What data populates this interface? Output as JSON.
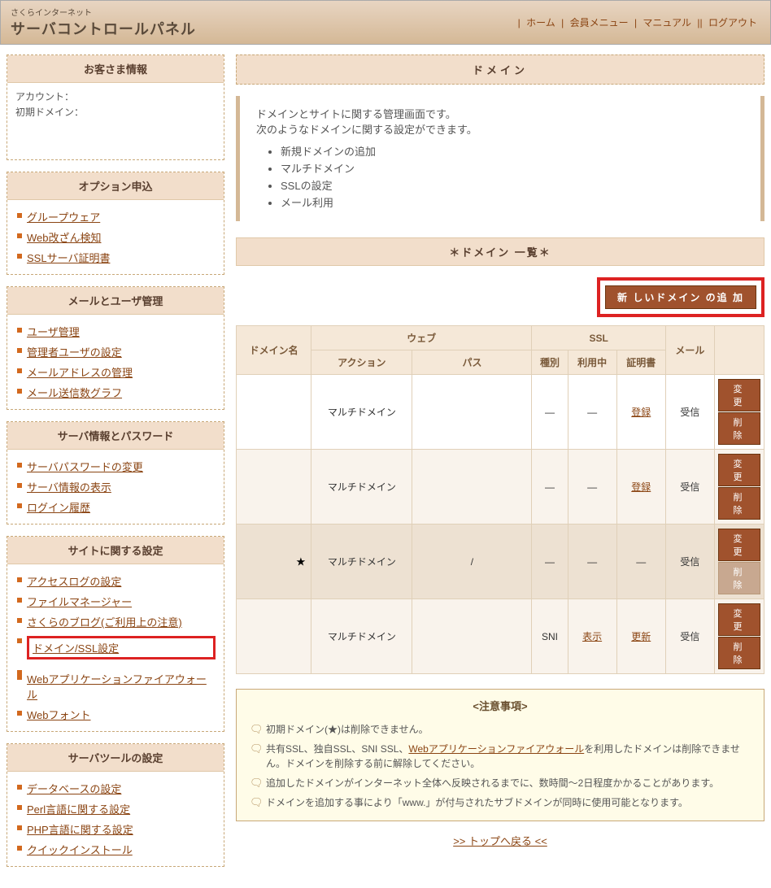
{
  "header": {
    "subtitle": "さくらインターネット",
    "title": "サーバコントロールパネル",
    "nav": {
      "home": "ホーム",
      "member": "会員メニュー",
      "manual": "マニュアル",
      "logout": "ログアウト"
    }
  },
  "sidebar": {
    "customer": {
      "title": "お客さま情報",
      "account_label": "アカウント：",
      "domain_label": "初期ドメイン："
    },
    "sections": [
      {
        "title": "オプション申込",
        "items": [
          {
            "label": "グループウェア",
            "hl": false
          },
          {
            "label": "Web改ざん検知",
            "hl": false
          },
          {
            "label": "SSLサーバ証明書",
            "hl": false
          }
        ]
      },
      {
        "title": "メールとユーザ管理",
        "items": [
          {
            "label": "ユーザ管理",
            "hl": false
          },
          {
            "label": "管理者ユーザの設定",
            "hl": false
          },
          {
            "label": "メールアドレスの管理",
            "hl": false
          },
          {
            "label": "メール送信数グラフ",
            "hl": false
          }
        ]
      },
      {
        "title": "サーバ情報とパスワード",
        "items": [
          {
            "label": "サーバパスワードの変更",
            "hl": false
          },
          {
            "label": "サーバ情報の表示",
            "hl": false
          },
          {
            "label": "ログイン履歴",
            "hl": false
          }
        ]
      },
      {
        "title": "サイトに関する設定",
        "items": [
          {
            "label": "アクセスログの設定",
            "hl": false
          },
          {
            "label": "ファイルマネージャー",
            "hl": false
          },
          {
            "label": "さくらのブログ(ご利用上の注意)",
            "hl": false
          },
          {
            "label": "ドメイン/SSL設定",
            "hl": true
          },
          {
            "label": "",
            "hl": false
          },
          {
            "label": "Webアプリケーションファイアウォール",
            "hl": false
          },
          {
            "label": "Webフォント",
            "hl": false
          }
        ]
      },
      {
        "title": "サーバツールの設定",
        "items": [
          {
            "label": "データベースの設定",
            "hl": false
          },
          {
            "label": "Perl言語に関する設定",
            "hl": false
          },
          {
            "label": "PHP言語に関する設定",
            "hl": false
          },
          {
            "label": "クイックインストール",
            "hl": false
          }
        ]
      }
    ]
  },
  "main": {
    "page_title": "ドメイン",
    "description": {
      "line1": "ドメインとサイトに関する管理画面です。",
      "line2": "次のようなドメインに関する設定ができます。",
      "bullets": [
        "新規ドメインの追加",
        "マルチドメイン",
        "SSLの設定",
        "メール利用"
      ]
    },
    "list_title": "＊ドメイン 一覧＊",
    "add_button": "新 しいドメイン の追 加",
    "table": {
      "h_domain": "ドメイン名",
      "h_web": "ウェブ",
      "h_action": "アクション",
      "h_path": "パス",
      "h_ssl": "SSL",
      "h_kind": "種別",
      "h_inuse": "利用中",
      "h_cert": "証明書",
      "h_mail": "メール",
      "rows": [
        {
          "star": false,
          "action": "マルチドメイン",
          "path": "",
          "kind": "―",
          "inuse": "―",
          "cert": "登録",
          "cert_link": true,
          "mail": "受信",
          "edit": true,
          "del": true,
          "alt": false
        },
        {
          "star": false,
          "action": "マルチドメイン",
          "path": "",
          "kind": "―",
          "inuse": "―",
          "cert": "登録",
          "cert_link": true,
          "mail": "受信",
          "edit": true,
          "del": true,
          "alt": true
        },
        {
          "star": true,
          "action": "マルチドメイン",
          "path": "/",
          "kind": "―",
          "inuse": "―",
          "cert": "―",
          "cert_link": false,
          "mail": "受信",
          "edit": true,
          "del": false,
          "alt": false,
          "dark": true
        },
        {
          "star": false,
          "action": "マルチドメイン",
          "path": "",
          "kind": "SNI",
          "inuse": "表示",
          "inuse_link": true,
          "cert": "更新",
          "cert_link": true,
          "mail": "受信",
          "edit": true,
          "del": true,
          "alt": true
        }
      ],
      "btn_edit": "変　更",
      "btn_del": "削　除"
    },
    "notes": {
      "title": "<注意事項>",
      "items": [
        {
          "text": "初期ドメイン(★)は削除できません。"
        },
        {
          "text": "共有SSL、独自SSL、SNI SSL、",
          "link": "Webアプリケーションファイアウォール",
          "after": "を利用したドメインは削除できません。ドメインを削除する前に解除してください。"
        },
        {
          "text": "追加したドメインがインターネット全体へ反映されるまでに、数時間～2日程度かかることがあります。"
        },
        {
          "text": "ドメインを追加する事により「www.」が付与されたサブドメインが同時に使用可能となります。"
        }
      ]
    },
    "back_top": ">> トップへ戻る <<"
  }
}
